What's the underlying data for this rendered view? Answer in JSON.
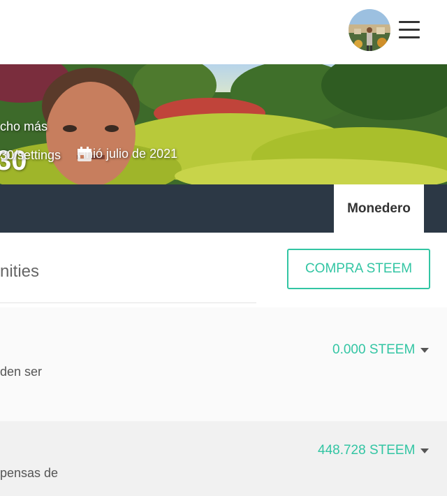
{
  "profile": {
    "name_partial": "30",
    "about_partial": "cho más",
    "url_partial": "30/settings",
    "joined": "Unió julio de 2021"
  },
  "tabs": {
    "wallet": "Monedero"
  },
  "main": {
    "communities_partial": "nities",
    "buy_button": "COMPRA STEEM"
  },
  "balances": [
    {
      "amount": "0.000 STEEM",
      "desc_partial": "den ser"
    },
    {
      "amount": "448.728 STEEM",
      "desc_partial": "pensas de"
    }
  ],
  "colors": {
    "accent": "#32c5a3",
    "nav_bg": "#2c3845"
  },
  "icons": {
    "menu": "hamburger-menu-icon",
    "calendar": "calendar-icon",
    "dropdown": "caret-down-icon"
  }
}
